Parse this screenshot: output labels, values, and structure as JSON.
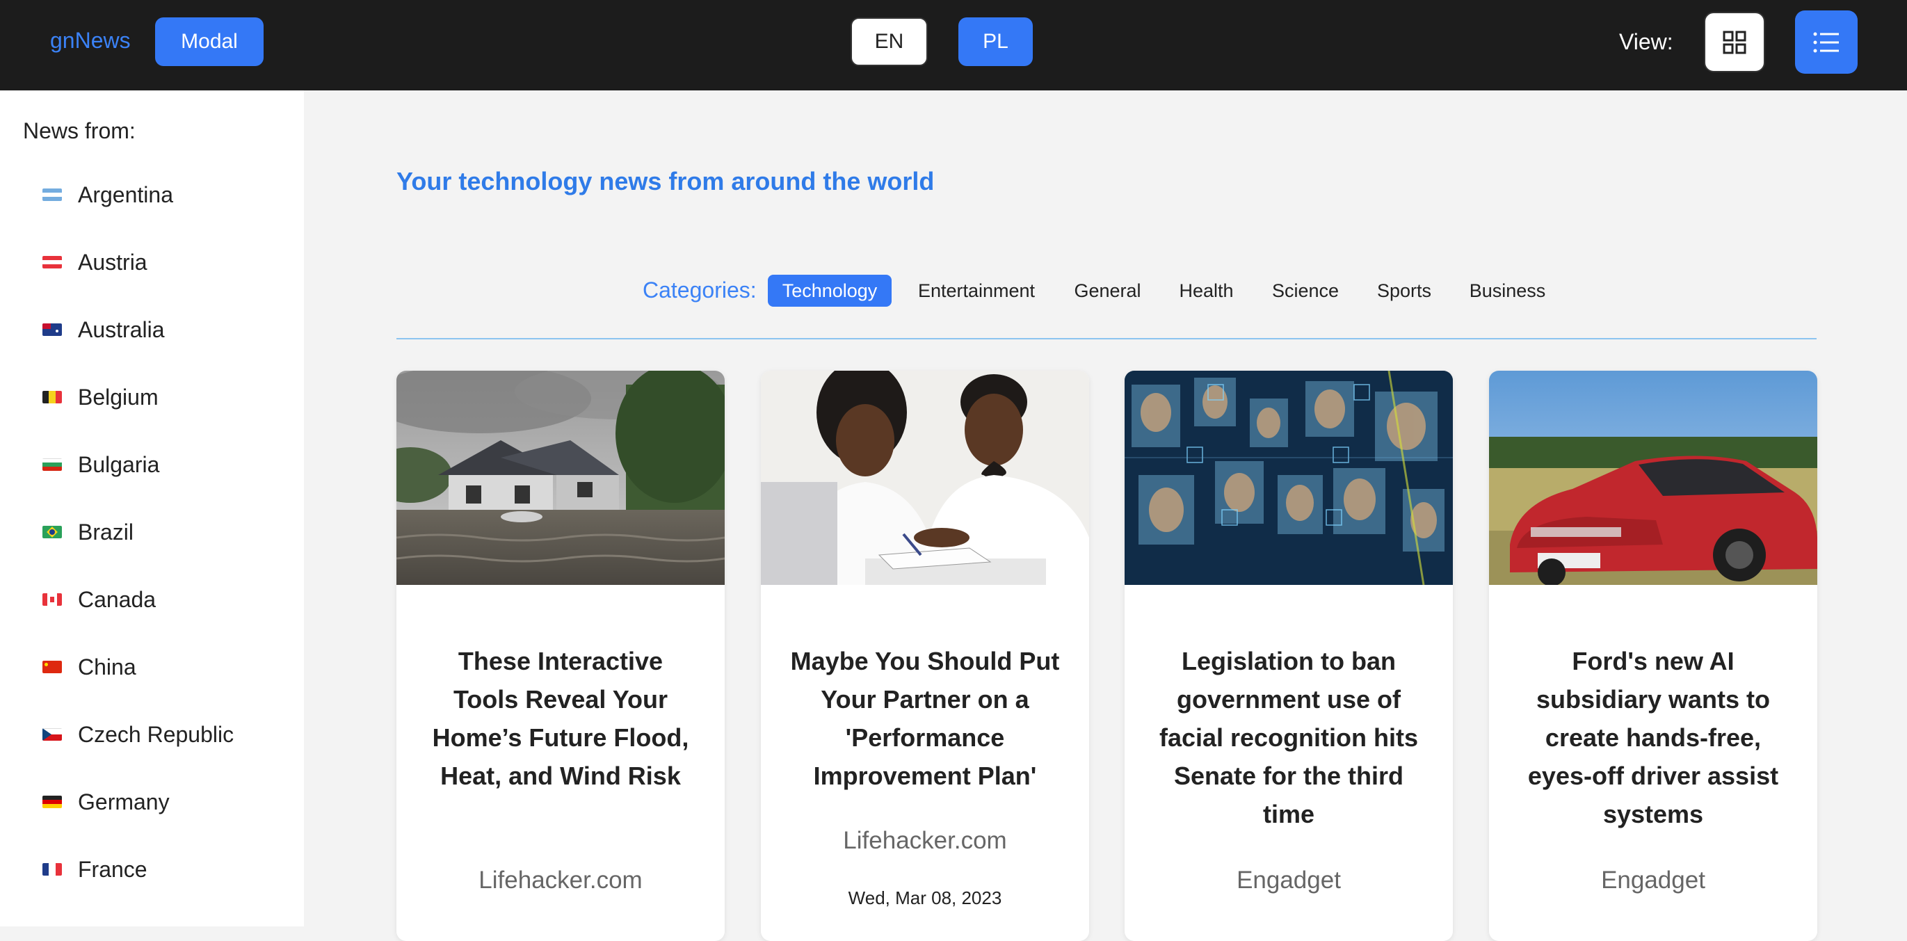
{
  "header": {
    "brand": "gnNews",
    "modal_label": "Modal",
    "languages": [
      "EN",
      "PL"
    ],
    "active_language": "PL",
    "view_label": "View:",
    "views": [
      "grid-icon",
      "list-icon"
    ],
    "active_view": "list",
    "accent": "#3478f6",
    "bar_color": "#1c1c1c"
  },
  "sidebar": {
    "title": "News from:",
    "countries": [
      {
        "name": "Argentina",
        "flag": "flag-argentina-icon"
      },
      {
        "name": "Austria",
        "flag": "flag-austria-icon"
      },
      {
        "name": "Australia",
        "flag": "flag-australia-icon"
      },
      {
        "name": "Belgium",
        "flag": "flag-belgium-icon"
      },
      {
        "name": "Bulgaria",
        "flag": "flag-bulgaria-icon"
      },
      {
        "name": "Brazil",
        "flag": "flag-brazil-icon"
      },
      {
        "name": "Canada",
        "flag": "flag-canada-icon"
      },
      {
        "name": "China",
        "flag": "flag-china-icon"
      },
      {
        "name": "Czech Republic",
        "flag": "flag-czech-republic-icon"
      },
      {
        "name": "Germany",
        "flag": "flag-germany-icon"
      },
      {
        "name": "France",
        "flag": "flag-france-icon"
      }
    ]
  },
  "main": {
    "tagline": "Your technology news from around the world",
    "categories_label": "Categories:",
    "categories": [
      "Technology",
      "Entertainment",
      "General",
      "Health",
      "Science",
      "Sports",
      "Business"
    ],
    "active_category": "Technology",
    "articles": [
      {
        "title": "These Interactive Tools Reveal Your Home’s Future Flood, Heat, and Wind Risk",
        "source": "Lifehacker.com",
        "date": "",
        "image": "flooded-house-image"
      },
      {
        "title": "Maybe You Should Put Your Partner on a 'Performance Improvement Plan'",
        "source": "Lifehacker.com",
        "date": "Wed, Mar 08, 2023",
        "image": "couple-writing-image"
      },
      {
        "title": "Legislation to ban government use of facial recognition hits Senate for the third time",
        "source": "Engadget",
        "date": "",
        "image": "facial-recognition-image"
      },
      {
        "title": "Ford's new AI subsidiary wants to create hands-free, eyes-off driver assist systems",
        "source": "Engadget",
        "date": "",
        "image": "red-car-image"
      }
    ]
  }
}
